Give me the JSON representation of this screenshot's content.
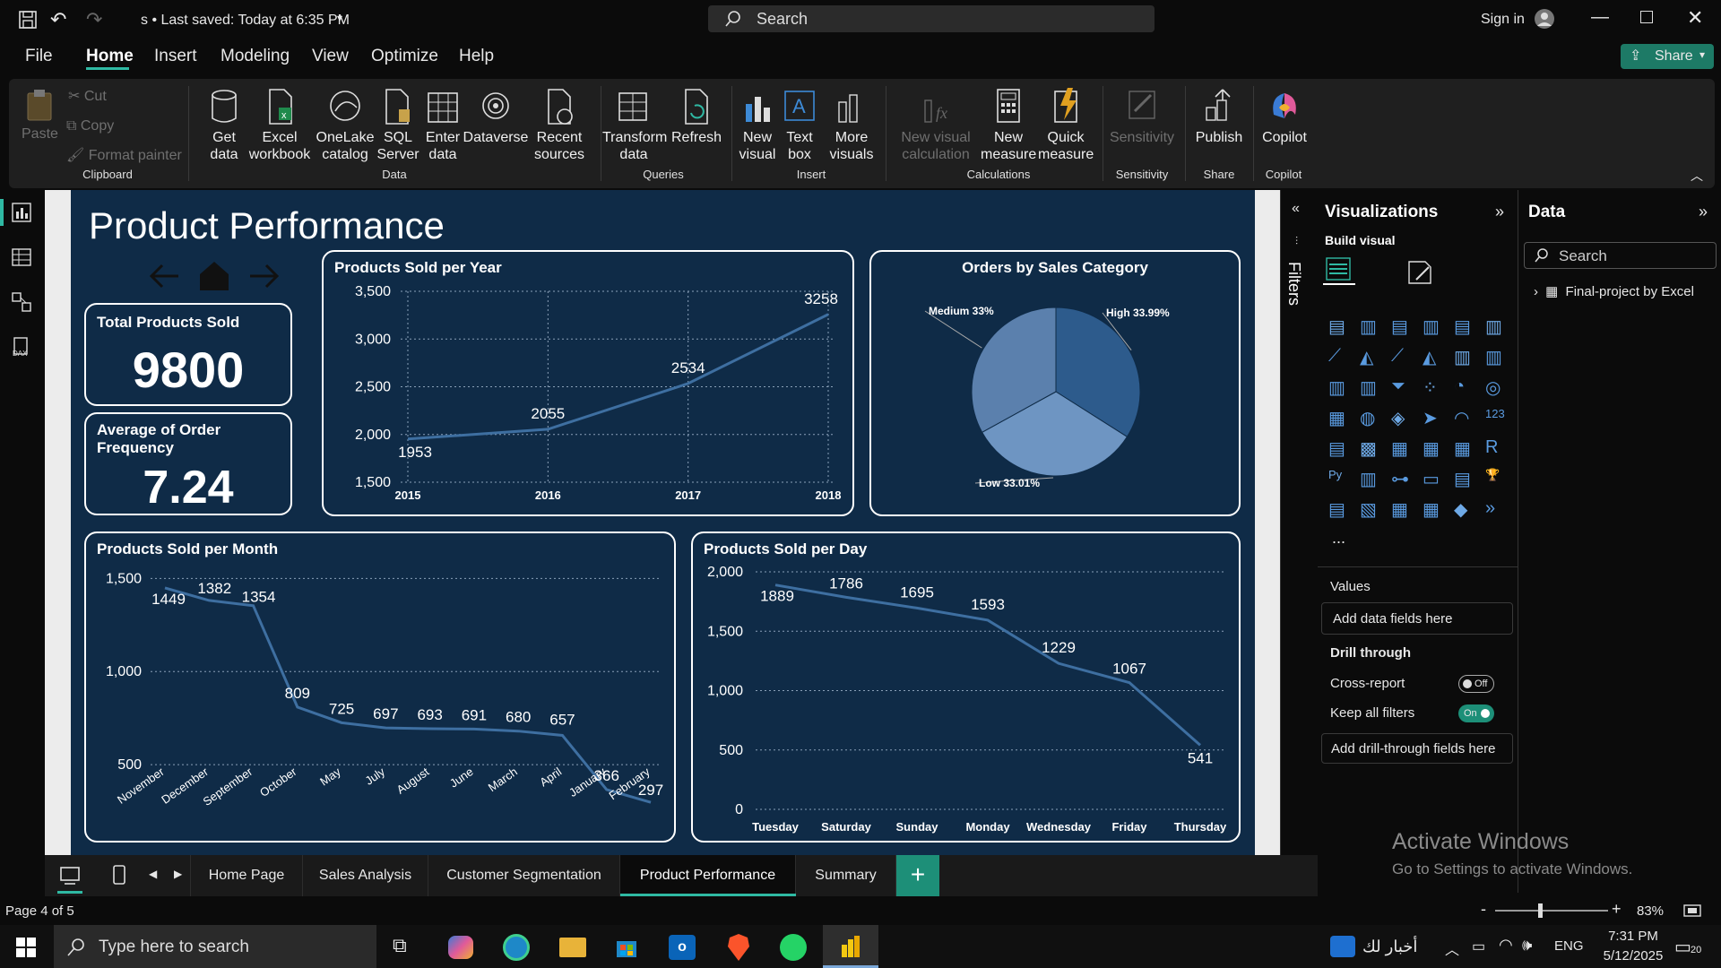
{
  "titlebar": {
    "doc_title": "s • Last saved: Today at 6:35 PM",
    "search_placeholder": "Search",
    "signin": "Sign in"
  },
  "menu": [
    "File",
    "Home",
    "Insert",
    "Modeling",
    "View",
    "Optimize",
    "Help"
  ],
  "share_label": "Share",
  "ribbon": {
    "clipboard": {
      "paste": "Paste",
      "cut": "Cut",
      "copy": "Copy",
      "format_painter": "Format painter",
      "group": "Clipboard"
    },
    "data": {
      "get_data": "Get data",
      "excel": "Excel workbook",
      "onelake": "OneLake catalog",
      "sql": "SQL Server",
      "enter": "Enter data",
      "dataverse": "Dataverse",
      "recent": "Recent sources",
      "group": "Data"
    },
    "queries": {
      "transform": "Transform data",
      "refresh": "Refresh",
      "group": "Queries"
    },
    "insert": {
      "new_visual": "New visual",
      "text_box": "Text box",
      "more_visuals": "More visuals",
      "group": "Insert"
    },
    "calc": {
      "new_visual_calc": "New visual calculation",
      "new_measure": "New measure",
      "quick_measure": "Quick measure",
      "group": "Calculations"
    },
    "sensitivity": {
      "label": "Sensitivity",
      "group": "Sensitivity"
    },
    "share": {
      "publish": "Publish",
      "group": "Share"
    },
    "copilot": {
      "label": "Copilot",
      "group": "Copilot"
    }
  },
  "report": {
    "title": "Product Performance",
    "kpi1": {
      "label": "Total Products Sold",
      "value": "9800"
    },
    "kpi2": {
      "label": "Average of Order Frequency",
      "value": "7.24"
    },
    "year_title": "Products Sold per Year",
    "pie_title": "Orders by Sales Category",
    "month_title": "Products Sold per Month",
    "day_title": "Products Sold per Day"
  },
  "chart_data": [
    {
      "type": "line",
      "title": "Products Sold per Year",
      "x": [
        2015,
        2016,
        2017,
        2018
      ],
      "values": [
        1953,
        2055,
        2534,
        3258
      ],
      "ylim": [
        1500,
        3500
      ],
      "yticks": [
        "1,500",
        "2,000",
        "2,500",
        "3,000",
        "3,500"
      ],
      "xticks": [
        "2015",
        "2016",
        "2017",
        "2018"
      ],
      "grid": true
    },
    {
      "type": "pie",
      "title": "Orders by Sales Category",
      "categories": [
        "High",
        "Low",
        "Medium"
      ],
      "values": [
        33.99,
        33.01,
        33
      ],
      "labels": [
        "High 33.99%",
        "Low 33.01%",
        "Medium 33%"
      ],
      "colors": [
        "#2d5b8c",
        "#6e95c2",
        "#5b80ad"
      ]
    },
    {
      "type": "line",
      "title": "Products Sold per Month",
      "categories": [
        "November",
        "December",
        "September",
        "October",
        "May",
        "July",
        "August",
        "June",
        "March",
        "April",
        "January",
        "February"
      ],
      "values": [
        1449,
        1382,
        1354,
        809,
        725,
        697,
        693,
        691,
        680,
        657,
        366,
        297
      ],
      "ylim": [
        250,
        1550
      ],
      "yticks": [
        "500",
        "1,000",
        "1,500"
      ],
      "grid": true
    },
    {
      "type": "line",
      "title": "Products Sold per Day",
      "categories": [
        "Tuesday",
        "Saturday",
        "Sunday",
        "Monday",
        "Wednesday",
        "Friday",
        "Thursday"
      ],
      "values": [
        1889,
        1786,
        1695,
        1593,
        1229,
        1067,
        541
      ],
      "ylim": [
        0,
        2000
      ],
      "yticks": [
        "0",
        "500",
        "1,000",
        "1,500",
        "2,000"
      ],
      "grid": true
    }
  ],
  "filters_label": "Filters",
  "viz": {
    "title": "Visualizations",
    "build": "Build visual",
    "values": "Values",
    "add_fields": "Add data fields here",
    "drill": "Drill through",
    "cross": "Cross-report",
    "cross_state": "Off",
    "keep": "Keep all filters",
    "keep_state": "On",
    "add_drill": "Add drill-through fields here",
    "more": "..."
  },
  "datapane": {
    "title": "Data",
    "search": "Search",
    "item": "Final-project by Excel"
  },
  "tabs": [
    "Home Page",
    "Sales Analysis",
    "Customer Segmentation",
    "Product Performance",
    "Summary"
  ],
  "status": {
    "page": "Page 4 of 5",
    "zoom": "83%"
  },
  "watermark": {
    "line1": "Activate Windows",
    "line2": "Go to Settings to activate Windows."
  },
  "taskbar": {
    "search": "Type here to search",
    "news": "أخبار لك",
    "lang": "ENG",
    "time": "7:31 PM",
    "date": "5/12/2025",
    "notif": "20"
  },
  "colors": {
    "accent": "#2fb9a3",
    "report_bg": "#0f2b47",
    "line": "#3e6fa1"
  }
}
